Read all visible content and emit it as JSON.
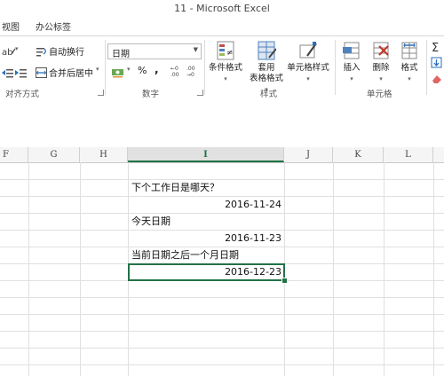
{
  "window": {
    "title": "11 - Microsoft Excel"
  },
  "tabs": [
    "视图",
    "办公标签"
  ],
  "ribbon": {
    "wrap_text": "自动换行",
    "merge_center": "合并后居中",
    "number_format": "日期",
    "percent": "%",
    "comma": ",",
    "conditional_format": "条件格式",
    "apply_table_format_line1": "套用",
    "apply_table_format_line2": "表格格式",
    "cell_styles": "单元格样式",
    "insert": "插入",
    "delete": "删除",
    "format": "格式",
    "groups": {
      "alignment": "对齐方式",
      "number": "数字",
      "styles": "样式",
      "cells": "单元格"
    }
  },
  "columns": [
    "F",
    "G",
    "H",
    "I",
    "J",
    "K",
    "L"
  ],
  "active_column": "I",
  "cells": {
    "r1": "下个工作日是哪天？",
    "r2": "2016-11-24",
    "r3": "今天日期",
    "r4": "2016-11-23",
    "r5": "当前日期之后一个月日期",
    "r6": "2016-12-23"
  },
  "colors": {
    "excel_green": "#217346",
    "gridline": "#e0e0e0",
    "header_bg": "#f5f5f5"
  }
}
